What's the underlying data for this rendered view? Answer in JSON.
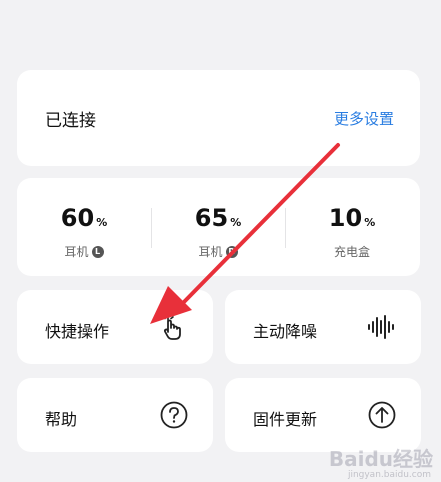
{
  "status": {
    "connected_label": "已连接",
    "more_settings": "更多设置"
  },
  "battery": [
    {
      "value": "60",
      "unit": "%",
      "label": "耳机",
      "side": "L"
    },
    {
      "value": "65",
      "unit": "%",
      "label": "耳机",
      "side": "R"
    },
    {
      "value": "10",
      "unit": "%",
      "label": "充电盒"
    }
  ],
  "tiles": {
    "quick": {
      "label": "快捷操作",
      "icon": "tap-gesture-icon"
    },
    "anc": {
      "label": "主动降噪",
      "icon": "sound-wave-icon"
    },
    "help": {
      "label": "帮助",
      "icon": "question-icon"
    },
    "firmware": {
      "label": "固件更新",
      "icon": "upload-arrow-icon"
    }
  },
  "watermark": {
    "brand": "Baidu经验",
    "url": "jingyan.baidu.com"
  },
  "colors": {
    "accent": "#2a7de1",
    "arrow": "#e8303a",
    "background": "#f2f2f4"
  }
}
